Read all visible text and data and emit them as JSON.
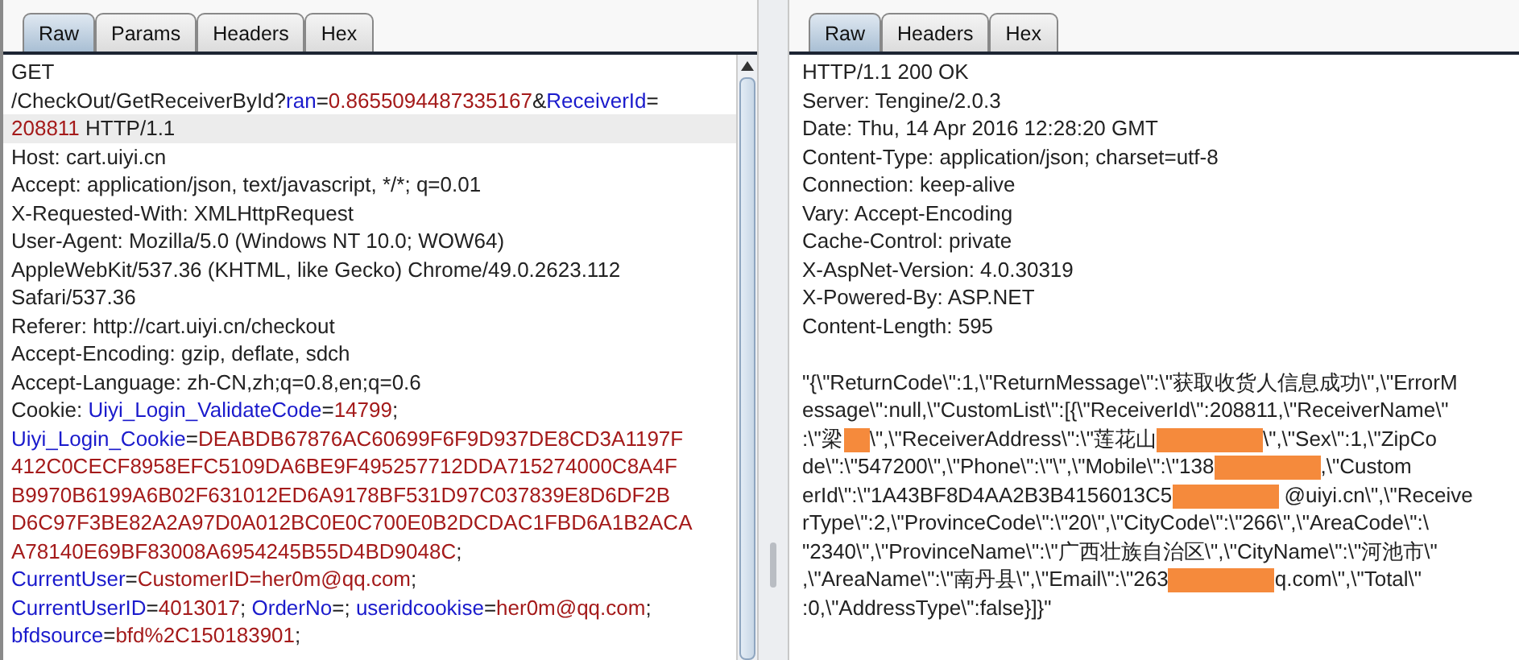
{
  "request": {
    "tabs": [
      {
        "label": "Raw",
        "selected": true
      },
      {
        "label": "Params",
        "selected": false
      },
      {
        "label": "Headers",
        "selected": false
      },
      {
        "label": "Hex",
        "selected": false
      }
    ],
    "lines": [
      {
        "current": false,
        "segments": [
          {
            "kind": "plain",
            "text": "GET"
          }
        ]
      },
      {
        "current": false,
        "segments": [
          {
            "kind": "plain",
            "text": "/CheckOut/GetReceiverById?"
          },
          {
            "kind": "name",
            "text": "ran"
          },
          {
            "kind": "plain",
            "text": "="
          },
          {
            "kind": "value",
            "text": "0.8655094487335167"
          },
          {
            "kind": "plain",
            "text": "&"
          },
          {
            "kind": "name",
            "text": "ReceiverId"
          },
          {
            "kind": "plain",
            "text": "="
          }
        ]
      },
      {
        "current": true,
        "segments": [
          {
            "kind": "value",
            "text": "208811"
          },
          {
            "kind": "plain",
            "text": " HTTP/1.1"
          }
        ]
      },
      {
        "current": false,
        "segments": [
          {
            "kind": "plain",
            "text": "Host: cart.uiyi.cn"
          }
        ]
      },
      {
        "current": false,
        "segments": [
          {
            "kind": "plain",
            "text": "Accept: application/json, text/javascript, */*; q=0.01"
          }
        ]
      },
      {
        "current": false,
        "segments": [
          {
            "kind": "plain",
            "text": "X-Requested-With: XMLHttpRequest"
          }
        ]
      },
      {
        "current": false,
        "segments": [
          {
            "kind": "plain",
            "text": "User-Agent: Mozilla/5.0 (Windows NT 10.0; WOW64)"
          }
        ]
      },
      {
        "current": false,
        "segments": [
          {
            "kind": "plain",
            "text": "AppleWebKit/537.36 (KHTML, like Gecko) Chrome/49.0.2623.112"
          }
        ]
      },
      {
        "current": false,
        "segments": [
          {
            "kind": "plain",
            "text": "Safari/537.36"
          }
        ]
      },
      {
        "current": false,
        "segments": [
          {
            "kind": "plain",
            "text": "Referer: http://cart.uiyi.cn/checkout"
          }
        ]
      },
      {
        "current": false,
        "segments": [
          {
            "kind": "plain",
            "text": "Accept-Encoding: gzip, deflate, sdch"
          }
        ]
      },
      {
        "current": false,
        "segments": [
          {
            "kind": "plain",
            "text": "Accept-Language: zh-CN,zh;q=0.8,en;q=0.6"
          }
        ]
      },
      {
        "current": false,
        "segments": [
          {
            "kind": "plain",
            "text": "Cookie: "
          },
          {
            "kind": "name",
            "text": "Uiyi_Login_ValidateCode"
          },
          {
            "kind": "plain",
            "text": "="
          },
          {
            "kind": "value",
            "text": "14799"
          },
          {
            "kind": "plain",
            "text": ";"
          }
        ]
      },
      {
        "current": false,
        "segments": [
          {
            "kind": "name",
            "text": "Uiyi_Login_Cookie"
          },
          {
            "kind": "plain",
            "text": "="
          },
          {
            "kind": "value",
            "text": "DEABDB67876AC60699F6F9D937DE8CD3A1197F"
          }
        ]
      },
      {
        "current": false,
        "segments": [
          {
            "kind": "value",
            "text": "412C0CECF8958EFC5109DA6BE9F495257712DDA715274000C8A4F"
          }
        ]
      },
      {
        "current": false,
        "segments": [
          {
            "kind": "value",
            "text": "B9970B6199A6B02F631012ED6A9178BF531D97C037839E8D6DF2B"
          }
        ]
      },
      {
        "current": false,
        "segments": [
          {
            "kind": "value",
            "text": "D6C97F3BE82A2A97D0A012BC0E0C700E0B2DCDAC1FBD6A1B2ACA"
          }
        ]
      },
      {
        "current": false,
        "segments": [
          {
            "kind": "value",
            "text": "A78140E69BF83008A6954245B55D4BD9048C"
          },
          {
            "kind": "plain",
            "text": ";"
          }
        ]
      },
      {
        "current": false,
        "segments": [
          {
            "kind": "name",
            "text": "CurrentUser"
          },
          {
            "kind": "plain",
            "text": "="
          },
          {
            "kind": "value",
            "text": "CustomerID=her0m@qq.com"
          },
          {
            "kind": "plain",
            "text": ";"
          }
        ]
      },
      {
        "current": false,
        "segments": [
          {
            "kind": "name",
            "text": "CurrentUserID"
          },
          {
            "kind": "plain",
            "text": "="
          },
          {
            "kind": "value",
            "text": "4013017"
          },
          {
            "kind": "plain",
            "text": "; "
          },
          {
            "kind": "name",
            "text": "OrderNo"
          },
          {
            "kind": "plain",
            "text": "=; "
          },
          {
            "kind": "name",
            "text": "useridcookise"
          },
          {
            "kind": "plain",
            "text": "="
          },
          {
            "kind": "value",
            "text": "her0m@qq.com"
          },
          {
            "kind": "plain",
            "text": ";"
          }
        ]
      },
      {
        "current": false,
        "segments": [
          {
            "kind": "name",
            "text": "bfdsource"
          },
          {
            "kind": "plain",
            "text": "="
          },
          {
            "kind": "value",
            "text": "bfd%2C150183901"
          },
          {
            "kind": "plain",
            "text": ";"
          }
        ]
      }
    ]
  },
  "response": {
    "tabs": [
      {
        "label": "Raw",
        "selected": true
      },
      {
        "label": "Headers",
        "selected": false
      },
      {
        "label": "Hex",
        "selected": false
      }
    ],
    "lines": [
      {
        "segments": [
          {
            "kind": "plain",
            "text": "HTTP/1.1 200 OK"
          }
        ]
      },
      {
        "segments": [
          {
            "kind": "plain",
            "text": "Server: Tengine/2.0.3"
          }
        ]
      },
      {
        "segments": [
          {
            "kind": "plain",
            "text": "Date: Thu, 14 Apr 2016 12:28:20 GMT"
          }
        ]
      },
      {
        "segments": [
          {
            "kind": "plain",
            "text": "Content-Type: application/json; charset=utf-8"
          }
        ]
      },
      {
        "segments": [
          {
            "kind": "plain",
            "text": "Connection: keep-alive"
          }
        ]
      },
      {
        "segments": [
          {
            "kind": "plain",
            "text": "Vary: Accept-Encoding"
          }
        ]
      },
      {
        "segments": [
          {
            "kind": "plain",
            "text": "Cache-Control: private"
          }
        ]
      },
      {
        "segments": [
          {
            "kind": "plain",
            "text": "X-AspNet-Version: 4.0.30319"
          }
        ]
      },
      {
        "segments": [
          {
            "kind": "plain",
            "text": "X-Powered-By: ASP.NET"
          }
        ]
      },
      {
        "segments": [
          {
            "kind": "plain",
            "text": "Content-Length: 595"
          }
        ]
      }
    ],
    "body_lines": [
      {
        "segments": [
          {
            "kind": "plain",
            "text": "\"{\\\"ReturnCode\\\":1,\\\"ReturnMessage\\\":\\\"获取收货人信息成功\\\",\\\"ErrorM"
          }
        ]
      },
      {
        "segments": [
          {
            "kind": "plain",
            "text": "essage\\\":null,\\\"CustomList\\\":[{\\\"ReceiverId\\\":208811,\\\"ReceiverName\\\""
          }
        ]
      },
      {
        "segments": [
          {
            "kind": "plain",
            "text": ":\\\"梁"
          },
          {
            "kind": "redacted-short"
          },
          {
            "kind": "plain",
            "text": "\\\",\\\"ReceiverAddress\\\":\\\"莲花山"
          },
          {
            "kind": "redacted"
          },
          {
            "kind": "plain",
            "text": "\\\",\\\"Sex\\\":1,\\\"ZipCo"
          }
        ]
      },
      {
        "segments": [
          {
            "kind": "plain",
            "text": "de\\\":\\\"547200\\\",\\\"Phone\\\":\\\"\\\",\\\"Mobile\\\":\\\"138"
          },
          {
            "kind": "redacted"
          },
          {
            "kind": "plain",
            "text": ",\\\"Custom"
          }
        ]
      },
      {
        "segments": [
          {
            "kind": "plain",
            "text": "erId\\\":\\\"1A43BF8D4AA2B3B4156013C5"
          },
          {
            "kind": "redacted"
          },
          {
            "kind": "plain",
            "text": " @uiyi.cn\\\",\\\"Receive"
          }
        ]
      },
      {
        "segments": [
          {
            "kind": "plain",
            "text": "rType\\\":2,\\\"ProvinceCode\\\":\\\"20\\\",\\\"CityCode\\\":\\\"266\\\",\\\"AreaCode\\\":\\"
          }
        ]
      },
      {
        "segments": [
          {
            "kind": "plain",
            "text": "\"2340\\\",\\\"ProvinceName\\\":\\\"广西壮族自治区\\\",\\\"CityName\\\":\\\"河池市\\\""
          }
        ]
      },
      {
        "segments": [
          {
            "kind": "plain",
            "text": ",\\\"AreaName\\\":\\\"南丹县\\\",\\\"Email\\\":\\\"263"
          },
          {
            "kind": "redacted"
          },
          {
            "kind": "plain",
            "text": "q.com\\\",\\\"Total\\\""
          }
        ]
      },
      {
        "segments": [
          {
            "kind": "plain",
            "text": ":0,\\\"AddressType\\\":false}]}\""
          }
        ]
      }
    ]
  }
}
